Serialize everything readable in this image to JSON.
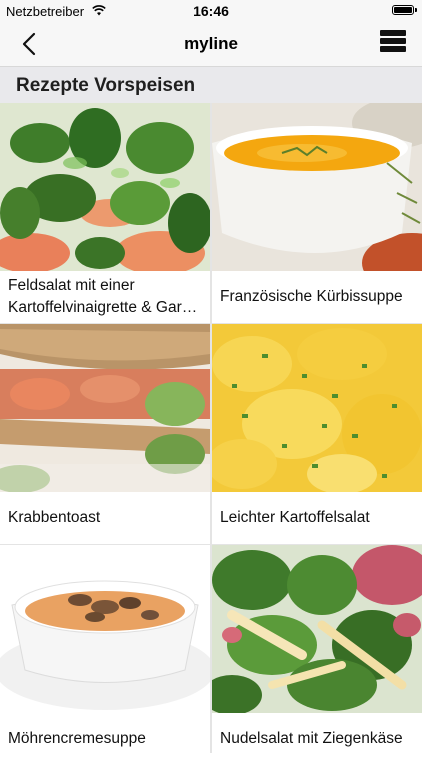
{
  "status_bar": {
    "carrier": "Netzbetreiber",
    "time": "16:46"
  },
  "nav": {
    "title": "myline",
    "back_icon": "chevron-left-icon",
    "menu_icon": "menu-icon"
  },
  "section": {
    "title": "Rezepte Vorspeisen"
  },
  "recipes": [
    {
      "title": "Feldsalat mit einer Kartoffelvinaigrette & Gar…",
      "image": "lamb's lettuce salad with shrimp"
    },
    {
      "title": "Französische Kürbissuppe",
      "image": "pumpkin soup in white bowl"
    },
    {
      "title": "Krabbentoast",
      "image": "toast sandwich with shrimp"
    },
    {
      "title": "Leichter Kartoffelsalat",
      "image": "potato salad with chives"
    },
    {
      "title": "Möhrencremesuppe",
      "image": "carrot cream soup with mushrooms"
    },
    {
      "title": "Nudelsalat mit Ziegenkäse",
      "image": "pasta salad with greens"
    }
  ]
}
